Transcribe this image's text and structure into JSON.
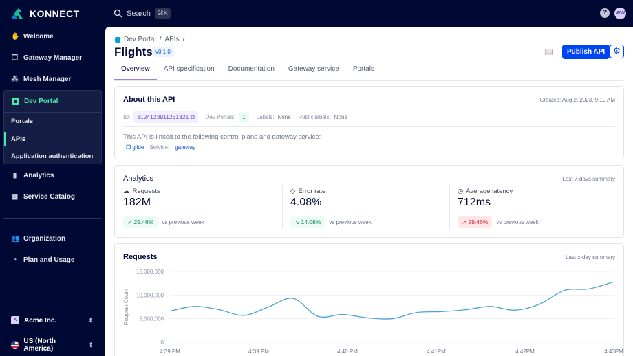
{
  "app": {
    "brand": "KONNECT",
    "search_label": "Search",
    "search_shortcut": "⌘K",
    "help_icon": "question-circle-icon",
    "avatar_initials": "WW"
  },
  "sidebar": {
    "items": [
      {
        "label": "Welcome",
        "icon": "wave-icon"
      },
      {
        "label": "Gateway Manager",
        "icon": "gateway-icon"
      },
      {
        "label": "Mesh Manager",
        "icon": "mesh-icon"
      }
    ],
    "dev_portal": {
      "label": "Dev Portal",
      "sub": [
        {
          "label": "Portals"
        },
        {
          "label": "APIs",
          "active": true
        },
        {
          "label": "Application authentication"
        }
      ]
    },
    "items2": [
      {
        "label": "Analytics",
        "icon": "bar-chart-icon"
      },
      {
        "label": "Service Catalog",
        "icon": "grid-icon"
      }
    ],
    "items3": [
      {
        "label": "Organization",
        "icon": "people-icon"
      },
      {
        "label": "Plan and Usage",
        "icon": "gauge-icon"
      }
    ],
    "org": {
      "initial": "A",
      "label": "Acme Inc."
    },
    "region": {
      "label": "US (North America)"
    }
  },
  "header": {
    "breadcrumb": [
      "Dev Portal",
      "/",
      "APIs",
      "/"
    ],
    "title": "Flights",
    "version": "v0.1.0",
    "publish_label": "Publish API"
  },
  "tabs": [
    {
      "label": "Overview",
      "active": true
    },
    {
      "label": "API specification"
    },
    {
      "label": "Documentation"
    },
    {
      "label": "Gateway service"
    },
    {
      "label": "Portals"
    }
  ],
  "about": {
    "title": "About this API",
    "created": "Created: Aug 2, 2023, 9:19 AM",
    "id_label": "ID:",
    "id": "3124123911231321",
    "dev_portals_label": "Dev Portals:",
    "dev_portals": "1",
    "labels_label": "Labels:",
    "labels": "None",
    "public_labels_label": "Public labels:",
    "public_labels": "None",
    "linked_text": "This API is linked to the following control plane and gateway service:",
    "control_plane": "glide",
    "service_label": "Service:",
    "service": "gateway"
  },
  "analytics": {
    "title": "Analytics",
    "summary": "Last 7-days summary",
    "stats": [
      {
        "label": "Requests",
        "value": "182M",
        "delta": "29.46%",
        "trend": "up",
        "status": "good",
        "vs": "vs previous week"
      },
      {
        "label": "Error rate",
        "value": "4.08%",
        "delta": "14.08%",
        "trend": "down",
        "status": "good",
        "vs": "vs previous week"
      },
      {
        "label": "Average latency",
        "value": "712ms",
        "delta": "29.46%",
        "trend": "up",
        "status": "bad",
        "vs": "vs previous week"
      }
    ]
  },
  "requests": {
    "title": "Requests",
    "summary": "Last x-day summary"
  },
  "colors": {
    "accent": "#0044f4",
    "sidebar_bg": "#000933",
    "dev_portal_green": "#4ce8a9",
    "line": "#4aa3d8"
  },
  "chart_data": {
    "type": "line",
    "ylabel": "Request Count",
    "ylim": [
      0,
      15000000
    ],
    "yticks": [
      "15,000,000",
      "10,000,000",
      "5,000,000",
      "0"
    ],
    "ytick_values": [
      15000000,
      10000000,
      5000000,
      0
    ],
    "xticks": [
      "4:39 PM",
      "4:39 PM",
      "4:40 PM",
      "4:41PM",
      "4:42PM",
      "4:43PM"
    ],
    "grid": true,
    "values": [
      6600000,
      7600000,
      6900000,
      5700000,
      7500000,
      9300000,
      5500000,
      5900000,
      5200000,
      5000000,
      6300000,
      6500000,
      6900000,
      7600000,
      6800000,
      8100000,
      11000000,
      11300000,
      12800000
    ]
  }
}
